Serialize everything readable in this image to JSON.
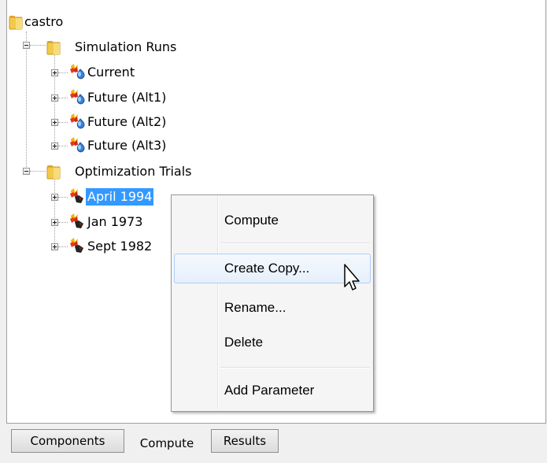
{
  "tree": {
    "root": {
      "label": "castro",
      "icon": "folder-icon"
    },
    "groups": [
      {
        "label": "Simulation Runs",
        "icon": "folder-icon",
        "expanded": true,
        "children": [
          {
            "label": "Current",
            "icon": "simulation-run-icon"
          },
          {
            "label": "Future (Alt1)",
            "icon": "simulation-run-icon"
          },
          {
            "label": "Future (Alt2)",
            "icon": "simulation-run-icon"
          },
          {
            "label": "Future (Alt3)",
            "icon": "simulation-run-icon"
          }
        ]
      },
      {
        "label": "Optimization Trials",
        "icon": "folder-icon",
        "expanded": true,
        "children": [
          {
            "label": "April 1994",
            "icon": "optimization-trial-icon",
            "selected": true
          },
          {
            "label": "Jan 1973",
            "icon": "optimization-trial-icon"
          },
          {
            "label": "Sept 1982",
            "icon": "optimization-trial-icon"
          }
        ]
      }
    ]
  },
  "context_menu": {
    "items": [
      {
        "label": "Compute"
      },
      {
        "label": "Create Copy..."
      },
      {
        "label": "Rename..."
      },
      {
        "label": "Delete"
      },
      {
        "label": "Add Parameter"
      }
    ],
    "hovered": "Create Copy..."
  },
  "tabs": [
    {
      "label": "Components",
      "active": false
    },
    {
      "label": "Compute",
      "active": true
    },
    {
      "label": "Results",
      "active": false
    }
  ],
  "colors": {
    "selection": "#3399ff",
    "menu_hover_border": "#aecff7",
    "folder": "#f3c94a"
  }
}
